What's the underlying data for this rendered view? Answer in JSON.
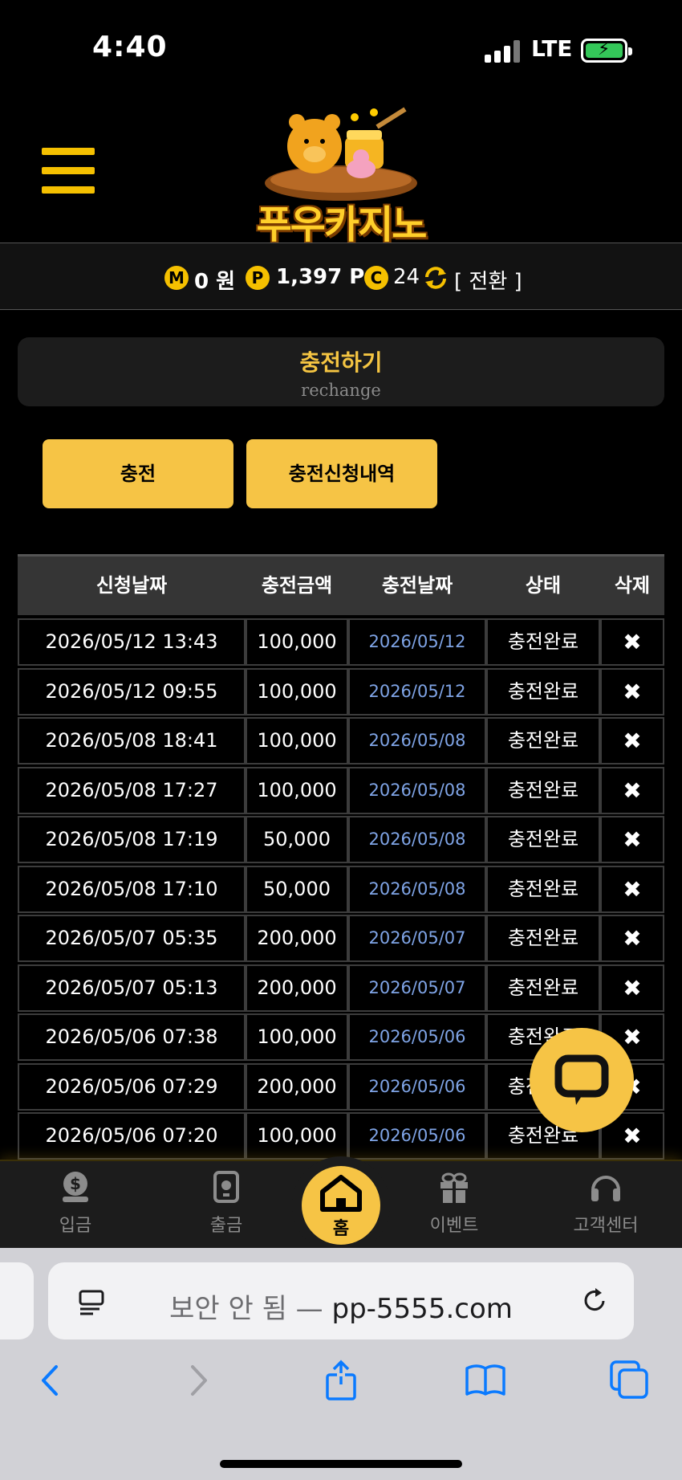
{
  "status_bar": {
    "time": "4:40",
    "network": "LTE"
  },
  "header": {
    "logo_text": "푸우카지노"
  },
  "points": {
    "money_badge": "M",
    "money": "0 원",
    "point_badge": "P",
    "point": "1,397 P",
    "coin_badge": "C",
    "coin": "24",
    "swap_label": "[ 전환 ]"
  },
  "section": {
    "title": "충전하기",
    "subtitle": "rechange"
  },
  "tabs": [
    {
      "label": "충전"
    },
    {
      "label": "충전신청내역"
    }
  ],
  "table": {
    "headers": [
      "신청날짜",
      "충전금액",
      "충전날짜",
      "상태",
      "삭제"
    ],
    "rows": [
      {
        "requested": "2026/05/12 13:43",
        "amount": "100,000",
        "charged": "2026/05/12",
        "status": "충전완료",
        "del": "✖"
      },
      {
        "requested": "2026/05/12 09:55",
        "amount": "100,000",
        "charged": "2026/05/12",
        "status": "충전완료",
        "del": "✖"
      },
      {
        "requested": "2026/05/08 18:41",
        "amount": "100,000",
        "charged": "2026/05/08",
        "status": "충전완료",
        "del": "✖"
      },
      {
        "requested": "2026/05/08 17:27",
        "amount": "100,000",
        "charged": "2026/05/08",
        "status": "충전완료",
        "del": "✖"
      },
      {
        "requested": "2026/05/08 17:19",
        "amount": "50,000",
        "charged": "2026/05/08",
        "status": "충전완료",
        "del": "✖"
      },
      {
        "requested": "2026/05/08 17:10",
        "amount": "50,000",
        "charged": "2026/05/08",
        "status": "충전완료",
        "del": "✖"
      },
      {
        "requested": "2026/05/07 05:35",
        "amount": "200,000",
        "charged": "2026/05/07",
        "status": "충전완료",
        "del": "✖"
      },
      {
        "requested": "2026/05/07 05:13",
        "amount": "200,000",
        "charged": "2026/05/07",
        "status": "충전완료",
        "del": "✖"
      },
      {
        "requested": "2026/05/06 07:38",
        "amount": "100,000",
        "charged": "2026/05/06",
        "status": "충전완료",
        "del": "✖"
      },
      {
        "requested": "2026/05/06 07:29",
        "amount": "200,000",
        "charged": "2026/05/06",
        "status": "충전완료",
        "del": "✖"
      },
      {
        "requested": "2026/05/06 07:20",
        "amount": "100,000",
        "charged": "2026/05/06",
        "status": "충전완료",
        "del": "✖"
      }
    ]
  },
  "bottom_nav": {
    "deposit": "입금",
    "withdraw": "출금",
    "home": "홈",
    "event": "이벤트",
    "support": "고객센터"
  },
  "safari": {
    "insecure_label": "보안 안 됨 —",
    "domain": "pp-5555.com"
  },
  "colors": {
    "accent": "#f6c445",
    "date_link": "#7fa4e6",
    "background": "#000000"
  }
}
